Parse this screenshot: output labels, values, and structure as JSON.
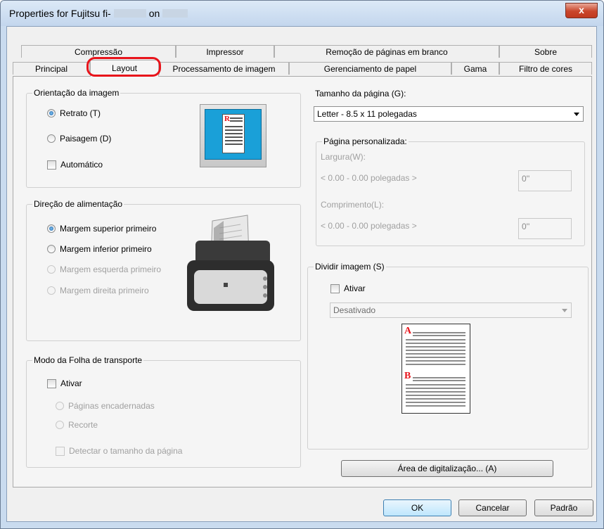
{
  "window": {
    "title_prefix": "Properties for Fujitsu fi-",
    "title_mid": "on",
    "close_label": "x"
  },
  "tabs_row1": [
    {
      "label": "Compressão"
    },
    {
      "label": "Impressor"
    },
    {
      "label": "Remoção de páginas em branco"
    },
    {
      "label": "Sobre"
    }
  ],
  "tabs_row2": [
    {
      "label": "Principal"
    },
    {
      "label": "Layout"
    },
    {
      "label": "Processamento de imagem"
    },
    {
      "label": "Gerenciamento de papel"
    },
    {
      "label": "Gama"
    },
    {
      "label": "Filtro de cores"
    }
  ],
  "orientation": {
    "label": "Orientação da imagem",
    "portrait": "Retrato (T)",
    "landscape": "Paisagem (D)",
    "auto": "Automático",
    "preview_letter": "R"
  },
  "feed": {
    "label": "Direção de alimentação",
    "options": [
      "Margem superior primeiro",
      "Margem inferior primeiro",
      "Margem esquerda primeiro",
      "Margem direita primeiro"
    ]
  },
  "carrier": {
    "label": "Modo da Folha de transporte",
    "enable": "Ativar",
    "bound": "Páginas encadernadas",
    "clip": "Recorte",
    "detect": "Detectar o tamanho da página"
  },
  "page_size": {
    "label": "Tamanho da página (G):",
    "value": "Letter - 8.5 x 11 polegadas",
    "custom_label": "Página personalizada:",
    "width_label": "Largura(W):",
    "width_range": "< 0.00 - 0.00 polegadas >",
    "width_value": "0''",
    "length_label": "Comprimento(L):",
    "length_range": "< 0.00 - 0.00 polegadas >",
    "length_value": "0''"
  },
  "split": {
    "label": "Dividir imagem (S)",
    "enable": "Ativar",
    "value": "Desativado",
    "letter_a": "A",
    "letter_b": "B"
  },
  "buttons": {
    "scan_area": "Área de digitalização... (A)",
    "ok": "OK",
    "cancel": "Cancelar",
    "default": "Padrão"
  },
  "colors": {
    "highlight": "#e8141b",
    "accent": "#1c5fa8"
  }
}
